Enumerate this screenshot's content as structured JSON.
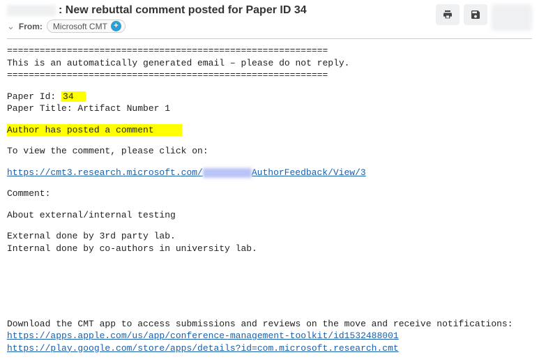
{
  "header": {
    "subject_suffix": ": New rebuttal comment posted for Paper ID 34",
    "from_label": "From:",
    "from_name": "Microsoft CMT"
  },
  "body": {
    "rule": "===========================================================",
    "auto_line": "This is an automatically generated email – please do not reply.",
    "paper_id_label": "Paper Id: ",
    "paper_id_value": "34  ",
    "paper_title_line": "Paper Title: Artifact Number 1",
    "author_posted": "Author has posted a comment",
    "view_line": "To view the comment, please click on:",
    "url_prefix": "https://cmt3.research.microsoft.com/",
    "url_suffix": "AuthorFeedback/View/3",
    "comment_label": "Comment:",
    "comment_subject": "About external/internal testing",
    "comment_l1": "External done by 3rd party lab.",
    "comment_l2": "Internal done by co-authors in university lab.",
    "download_line": "Download the CMT app to access submissions and reviews on the move and receive notifications:",
    "app_ios": "https://apps.apple.com/us/app/conference-management-toolkit/id1532488001",
    "app_android": "https://play.google.com/store/apps/details?id=com.microsoft.research.cmt"
  }
}
